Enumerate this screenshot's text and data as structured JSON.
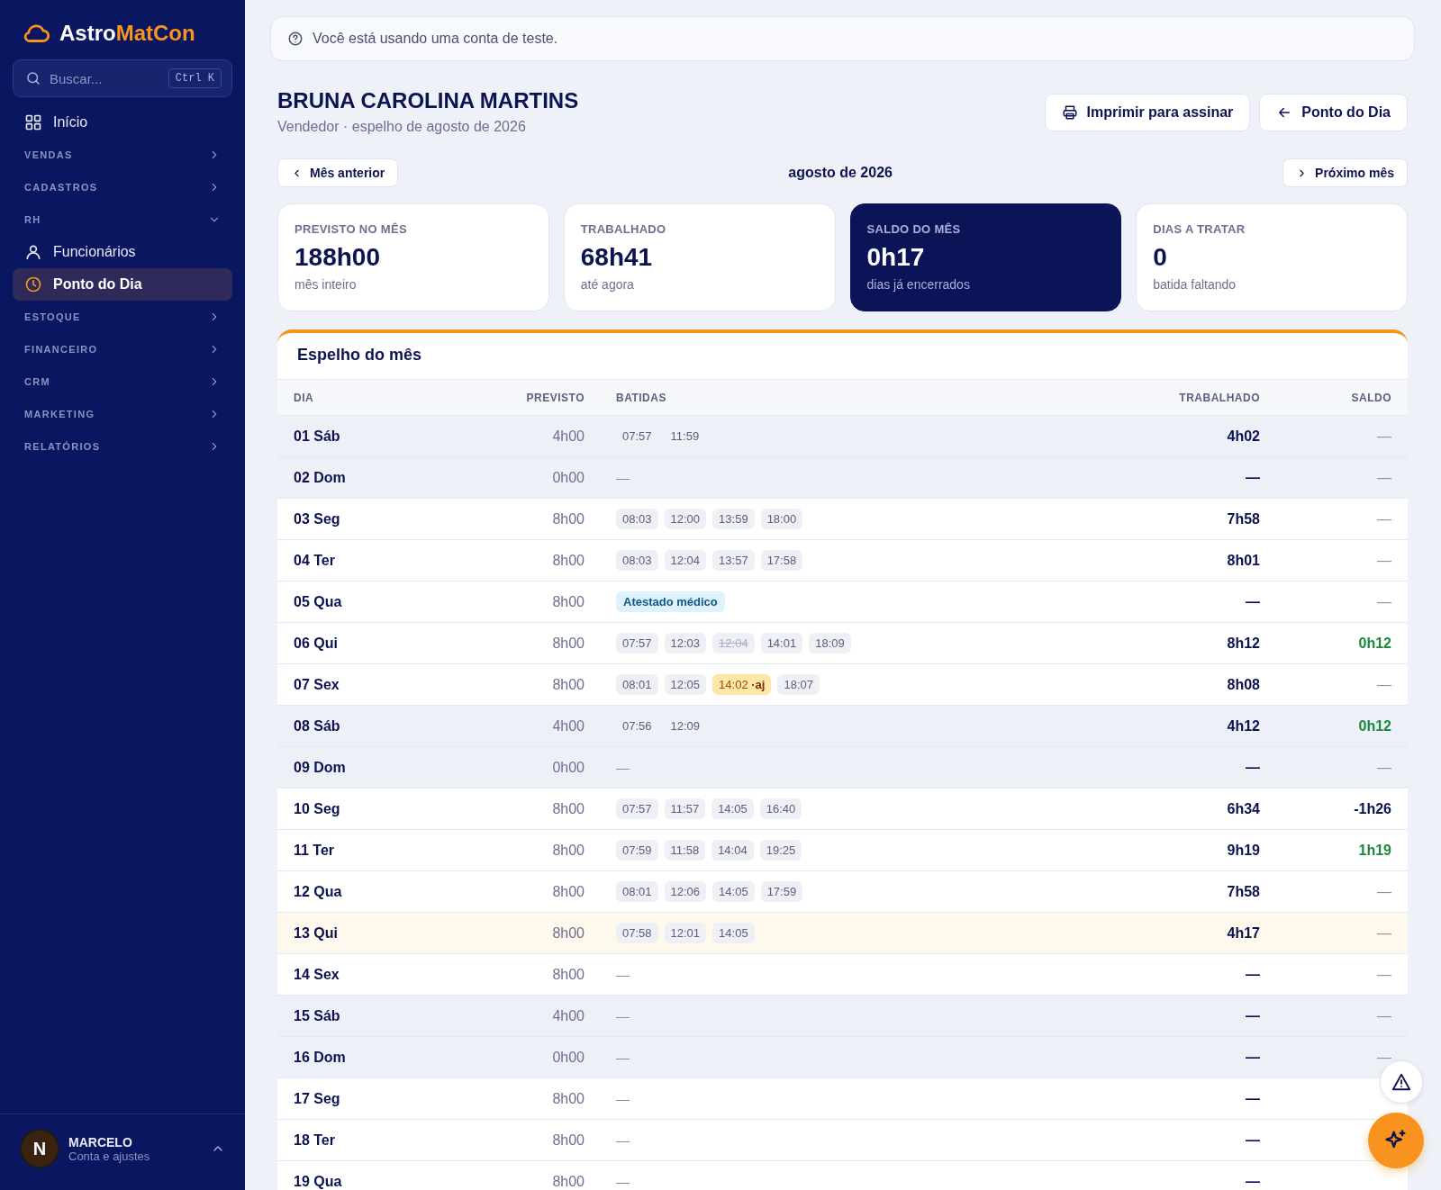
{
  "brand": {
    "first": "Astro",
    "second": "MatCon"
  },
  "search": {
    "placeholder": "Buscar...",
    "shortcut": "Ctrl K"
  },
  "nav": [
    {
      "kind": "link",
      "label": "Início",
      "selected": false
    },
    {
      "kind": "section",
      "label": "VENDAS",
      "expanded": false
    },
    {
      "kind": "section",
      "label": "CADASTROS",
      "expanded": false
    },
    {
      "kind": "section",
      "label": "RH",
      "expanded": true,
      "children": [
        {
          "label": "Funcionários",
          "selected": false
        },
        {
          "label": "Ponto do Dia",
          "selected": true
        }
      ]
    },
    {
      "kind": "section",
      "label": "ESTOQUE",
      "expanded": false
    },
    {
      "kind": "section",
      "label": "FINANCEIRO",
      "expanded": false
    },
    {
      "kind": "section",
      "label": "CRM",
      "expanded": false
    },
    {
      "kind": "section",
      "label": "MARKETING",
      "expanded": false
    },
    {
      "kind": "section",
      "label": "RELATÓRIOS",
      "expanded": false
    }
  ],
  "user": {
    "initial": "N",
    "name": "MARCELO",
    "subtitle": "Conta e ajustes"
  },
  "notice": "Você está usando uma conta de teste.",
  "employee": {
    "name": "BRUNA CAROLINA MARTINS",
    "subtitle": "Vendedor · espelho de agosto de 2026"
  },
  "actions": [
    "Imprimir para assinar",
    "Ponto do Dia"
  ],
  "month_nav": {
    "previous": "Mês anterior",
    "current": "agosto de 2026",
    "next": "Próximo mês"
  },
  "stats": [
    {
      "label": "PREVISTO NO MÊS",
      "value": "188h00",
      "note": "mês inteiro",
      "emphasis": false
    },
    {
      "label": "TRABALHADO",
      "value": "68h41",
      "note": "até agora",
      "emphasis": false
    },
    {
      "label": "SALDO DO MÊS",
      "value": "0h17",
      "note": "dias já encerrados",
      "emphasis": true
    },
    {
      "label": "DIAS A TRATAR",
      "value": "0",
      "note": "batida faltando",
      "emphasis": false
    }
  ],
  "table": {
    "title": "Espelho do mês",
    "columns": [
      "DIA",
      "PREVISTO",
      "BATIDAS",
      "TRABALHADO",
      "SALDO"
    ],
    "rows": [
      {
        "day": "01 Sáb",
        "expected": "4h00",
        "punches": [
          {
            "time": "07:57",
            "kind": "normal"
          },
          {
            "time": "11:59",
            "kind": "normal"
          }
        ],
        "worked": "4h02",
        "balance": {
          "text": "—",
          "color": "#8a8fa8",
          "bold": false
        },
        "weekend": true,
        "today": false
      },
      {
        "day": "02 Dom",
        "expected": "0h00",
        "empty": "—",
        "worked": "—",
        "balance": {
          "text": "—",
          "color": "#8a8fa8",
          "bold": false
        },
        "weekend": true,
        "today": false
      },
      {
        "day": "03 Seg",
        "expected": "8h00",
        "punches": [
          {
            "time": "08:03",
            "kind": "normal"
          },
          {
            "time": "12:00",
            "kind": "normal"
          },
          {
            "time": "13:59",
            "kind": "normal"
          },
          {
            "time": "18:00",
            "kind": "normal"
          }
        ],
        "worked": "7h58",
        "balance": {
          "text": "—",
          "color": "#8a8fa8",
          "bold": false
        },
        "weekend": false,
        "today": false
      },
      {
        "day": "04 Ter",
        "expected": "8h00",
        "punches": [
          {
            "time": "08:03",
            "kind": "normal"
          },
          {
            "time": "12:04",
            "kind": "normal"
          },
          {
            "time": "13:57",
            "kind": "normal"
          },
          {
            "time": "17:58",
            "kind": "normal"
          }
        ],
        "worked": "8h01",
        "balance": {
          "text": "—",
          "color": "#8a8fa8",
          "bold": false
        },
        "weekend": false,
        "today": false
      },
      {
        "day": "05 Qua",
        "expected": "8h00",
        "note": "Atestado médico",
        "worked": "—",
        "balance": {
          "text": "—",
          "color": "#8a8fa8",
          "bold": false
        },
        "weekend": false,
        "today": false
      },
      {
        "day": "06 Qui",
        "expected": "8h00",
        "punches": [
          {
            "time": "07:57",
            "kind": "normal"
          },
          {
            "time": "12:03",
            "kind": "normal"
          },
          {
            "time": "12:04",
            "kind": "removed"
          },
          {
            "time": "14:01",
            "kind": "normal"
          },
          {
            "time": "18:09",
            "kind": "normal"
          }
        ],
        "worked": "8h12",
        "balance": {
          "text": "0h12",
          "color": "#1a8a3a",
          "bold": true
        },
        "weekend": false,
        "today": false
      },
      {
        "day": "07 Sex",
        "expected": "8h00",
        "punches": [
          {
            "time": "08:01",
            "kind": "normal"
          },
          {
            "time": "12:05",
            "kind": "normal"
          },
          {
            "time": "14:02",
            "kind": "adjusted",
            "tag": "·aj"
          },
          {
            "time": "18:07",
            "kind": "normal"
          }
        ],
        "worked": "8h08",
        "balance": {
          "text": "—",
          "color": "#8a8fa8",
          "bold": false
        },
        "weekend": false,
        "today": false
      },
      {
        "day": "08 Sáb",
        "expected": "4h00",
        "punches": [
          {
            "time": "07:56",
            "kind": "normal"
          },
          {
            "time": "12:09",
            "kind": "normal"
          }
        ],
        "worked": "4h12",
        "balance": {
          "text": "0h12",
          "color": "#1a8a3a",
          "bold": true
        },
        "weekend": true,
        "today": false
      },
      {
        "day": "09 Dom",
        "expected": "0h00",
        "empty": "—",
        "worked": "—",
        "balance": {
          "text": "—",
          "color": "#8a8fa8",
          "bold": false
        },
        "weekend": true,
        "today": false
      },
      {
        "day": "10 Seg",
        "expected": "8h00",
        "punches": [
          {
            "time": "07:57",
            "kind": "normal"
          },
          {
            "time": "11:57",
            "kind": "normal"
          },
          {
            "time": "14:05",
            "kind": "normal"
          },
          {
            "time": "16:40",
            "kind": "normal"
          }
        ],
        "worked": "6h34",
        "balance": {
          "text": "-1h26",
          "color": "#0b1450",
          "bold": true
        },
        "weekend": false,
        "today": false
      },
      {
        "day": "11 Ter",
        "expected": "8h00",
        "punches": [
          {
            "time": "07:59",
            "kind": "normal"
          },
          {
            "time": "11:58",
            "kind": "normal"
          },
          {
            "time": "14:04",
            "kind": "normal"
          },
          {
            "time": "19:25",
            "kind": "normal"
          }
        ],
        "worked": "9h19",
        "balance": {
          "text": "1h19",
          "color": "#1a8a3a",
          "bold": true
        },
        "weekend": false,
        "today": false
      },
      {
        "day": "12 Qua",
        "expected": "8h00",
        "punches": [
          {
            "time": "08:01",
            "kind": "normal"
          },
          {
            "time": "12:06",
            "kind": "normal"
          },
          {
            "time": "14:05",
            "kind": "normal"
          },
          {
            "time": "17:59",
            "kind": "normal"
          }
        ],
        "worked": "7h58",
        "balance": {
          "text": "—",
          "color": "#8a8fa8",
          "bold": false
        },
        "weekend": false,
        "today": false
      },
      {
        "day": "13 Qui",
        "expected": "8h00",
        "punches": [
          {
            "time": "07:58",
            "kind": "normal"
          },
          {
            "time": "12:01",
            "kind": "normal"
          },
          {
            "time": "14:05",
            "kind": "normal"
          }
        ],
        "worked": "4h17",
        "balance": {
          "text": "—",
          "color": "#8a8fa8",
          "bold": false
        },
        "weekend": false,
        "today": true
      },
      {
        "day": "14 Sex",
        "expected": "8h00",
        "empty": "—",
        "worked": "—",
        "balance": {
          "text": "—",
          "color": "#8a8fa8",
          "bold": false
        },
        "weekend": false,
        "today": false
      },
      {
        "day": "15 Sáb",
        "expected": "4h00",
        "empty": "—",
        "worked": "—",
        "balance": {
          "text": "—",
          "color": "#8a8fa8",
          "bold": false
        },
        "weekend": true,
        "today": false
      },
      {
        "day": "16 Dom",
        "expected": "0h00",
        "empty": "—",
        "worked": "—",
        "balance": {
          "text": "—",
          "color": "#8a8fa8",
          "bold": false
        },
        "weekend": true,
        "today": false
      },
      {
        "day": "17 Seg",
        "expected": "8h00",
        "empty": "—",
        "worked": "—",
        "weekend": false,
        "today": false
      },
      {
        "day": "18 Ter",
        "expected": "8h00",
        "empty": "—",
        "worked": "—",
        "weekend": false,
        "today": false
      },
      {
        "day": "19 Qua",
        "expected": "8h00",
        "empty": "—",
        "worked": "—",
        "weekend": false,
        "today": false
      }
    ]
  }
}
